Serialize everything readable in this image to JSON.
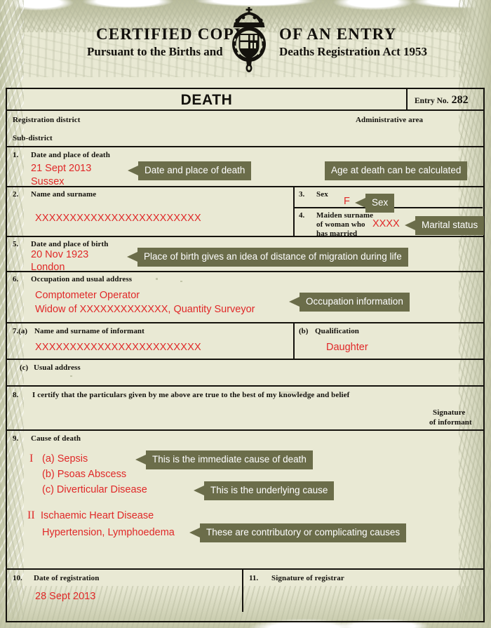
{
  "masthead": {
    "line1_left": "CERTIFIED COPY",
    "line1_right": "OF AN ENTRY",
    "line2_left": "Pursuant to the Births and",
    "line2_right": "Deaths Registration Act 1953",
    "crest_icon": "royal-coat-of-arms-icon"
  },
  "certificate": {
    "title": "DEATH",
    "entry_label": "Entry No.",
    "entry_number": "282",
    "registration_district_label": "Registration district",
    "administrative_area_label": "Administrative area",
    "sub_district_label": "Sub-district",
    "fields": {
      "f1": {
        "number": "1.",
        "label": "Date and place of death",
        "value_line1": "21 Sept 2013",
        "value_line2": "Sussex"
      },
      "f2": {
        "number": "2.",
        "label": "Name and  surname",
        "value": "XXXXXXXXXXXXXXXXXXXXXXXX"
      },
      "f3": {
        "number": "3.",
        "label": "Sex",
        "value": "F"
      },
      "f4": {
        "number": "4.",
        "label_line1": "Maiden surname",
        "label_line2": "of woman who",
        "label_line3": "has married",
        "value": "XXXX"
      },
      "f5": {
        "number": "5.",
        "label": "Date and place of birth",
        "value_line1": "20 Nov 1923",
        "value_line2": "London"
      },
      "f6": {
        "number": "6.",
        "label": "Occupation and usual address",
        "value_line1": "Comptometer Operator",
        "value_line2": "Widow of XXXXXXXXXXXXX, Quantity Surveyor"
      },
      "f7a": {
        "number": "7.(a)",
        "label": "Name and  surname of informant",
        "value": "XXXXXXXXXXXXXXXXXXXXXXXX"
      },
      "f7b": {
        "number": "(b)",
        "label": "Qualification",
        "value": "Daughter"
      },
      "f7c": {
        "number": "(c)",
        "label": "Usual address"
      },
      "f8": {
        "number": "8.",
        "label": "I certify that the particulars given by me above are true to the best of my knowledge and belief",
        "signature_line1": "Signature",
        "signature_line2": "of  informant"
      },
      "f9": {
        "number": "9.",
        "label": "Cause of death",
        "part1_numeral": "I",
        "part1_a": "(a) Sepsis",
        "part1_b": "(b) Psoas Abscess",
        "part1_c": "(c) Diverticular Disease",
        "part2_numeral": "II",
        "part2_line1": "Ischaemic Heart Disease",
        "part2_line2": "Hypertension, Lymphoedema"
      },
      "f10": {
        "number": "10.",
        "label": "Date of registration",
        "value": "28 Sept 2013"
      },
      "f11": {
        "number": "11.",
        "label": "Signature of registrar"
      }
    }
  },
  "callouts": {
    "date_place_death": "Date and place of death",
    "age_at_death": "Age at death can be calculated",
    "sex": "Sex",
    "marital_status": "Marital status",
    "place_of_birth": "Place of birth gives an idea of distance of migration during life",
    "occupation": "Occupation information",
    "immediate_cause": "This is the immediate cause of death",
    "underlying_cause": "This is the underlying cause",
    "contributory_causes": "These are contributory or complicating causes"
  },
  "colors": {
    "parchment": "#e9e9d4",
    "border_ink": "#14120d",
    "handwriting_red": "#e02828",
    "callout_olive": "#6b6d4a",
    "grunge_green": "#b7ba9e"
  }
}
